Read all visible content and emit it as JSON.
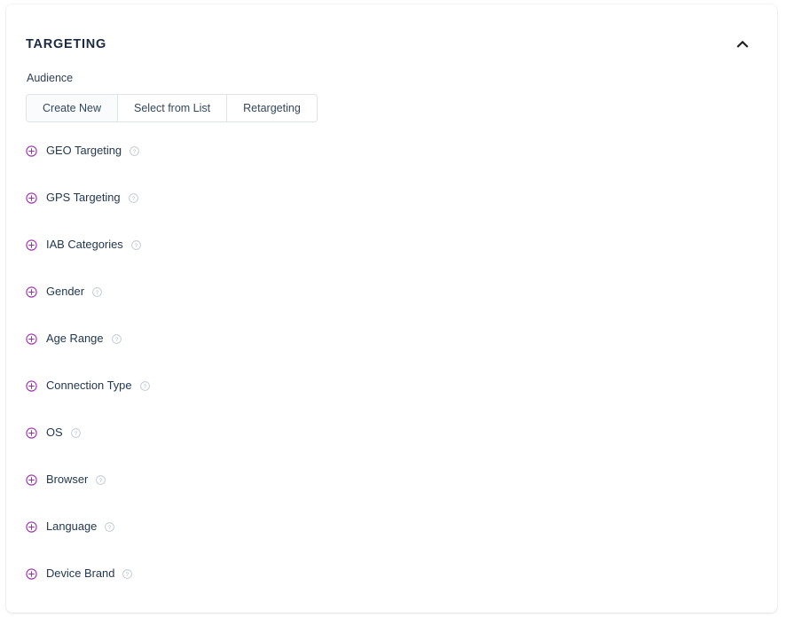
{
  "card": {
    "title": "TARGETING",
    "collapse_icon": "chevron-up-icon",
    "collapsed": false
  },
  "audience": {
    "label": "Audience",
    "selected": "Create New",
    "options": [
      {
        "label": "Create New",
        "active": true
      },
      {
        "label": "Select from List",
        "active": false
      },
      {
        "label": "Retargeting",
        "active": false
      }
    ]
  },
  "targeting_options": [
    {
      "label": "GEO Targeting",
      "expand_icon": "plus-circle-icon",
      "help_icon": "question-circle-icon"
    },
    {
      "label": "GPS Targeting",
      "expand_icon": "plus-circle-icon",
      "help_icon": "question-circle-icon"
    },
    {
      "label": "IAB Categories",
      "expand_icon": "plus-circle-icon",
      "help_icon": "question-circle-icon"
    },
    {
      "label": "Gender",
      "expand_icon": "plus-circle-icon",
      "help_icon": "question-circle-icon"
    },
    {
      "label": "Age Range",
      "expand_icon": "plus-circle-icon",
      "help_icon": "question-circle-icon"
    },
    {
      "label": "Connection Type",
      "expand_icon": "plus-circle-icon",
      "help_icon": "question-circle-icon"
    },
    {
      "label": "OS",
      "expand_icon": "plus-circle-icon",
      "help_icon": "question-circle-icon"
    },
    {
      "label": "Browser",
      "expand_icon": "plus-circle-icon",
      "help_icon": "question-circle-icon"
    },
    {
      "label": "Language",
      "expand_icon": "plus-circle-icon",
      "help_icon": "question-circle-icon"
    },
    {
      "label": "Device Brand",
      "expand_icon": "plus-circle-icon",
      "help_icon": "question-circle-icon"
    }
  ],
  "colors": {
    "accent_purple": "#9b2fae",
    "title_navy": "#1b2b44",
    "label_slate": "#22384f",
    "border_gray": "#dfe3e8",
    "help_gray": "#c3c9d4",
    "card_bg": "#ffffff",
    "active_seg_bg": "#fafbfc"
  }
}
